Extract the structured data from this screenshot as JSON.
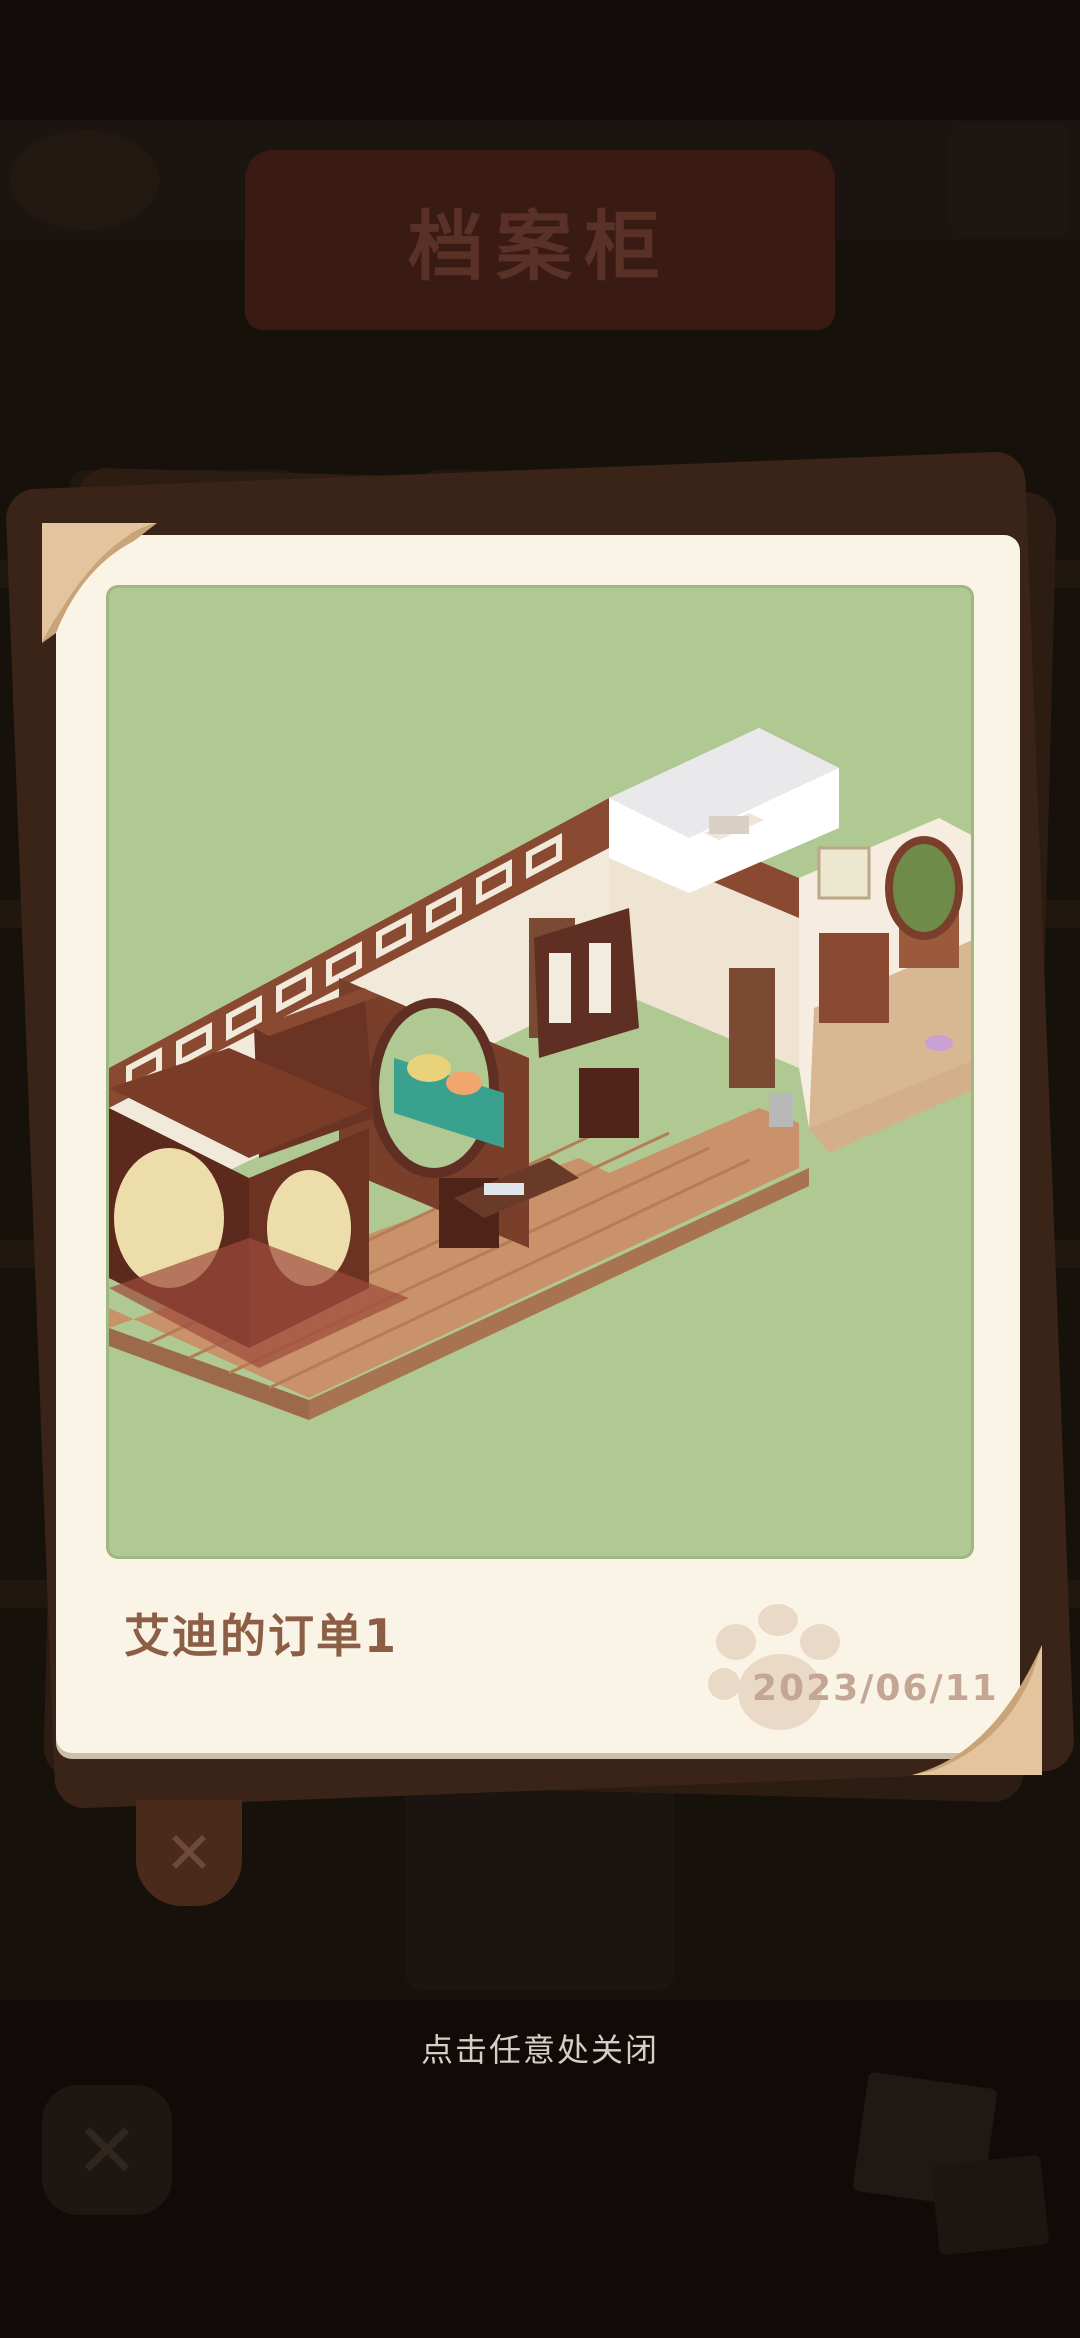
{
  "background": {
    "header_title": "档案柜",
    "close_tab_glyph": "✕",
    "bottom_close_glyph": "✕"
  },
  "photo": {
    "caption": "艾迪的订单1",
    "date": "2023/06/11",
    "image_subject": "isometric-chinese-style-room",
    "frame_color": "#b0c891",
    "paper_color": "#faf4e6",
    "caption_color": "#8b5e45"
  },
  "hint": {
    "text": "点击任意处关闭"
  }
}
